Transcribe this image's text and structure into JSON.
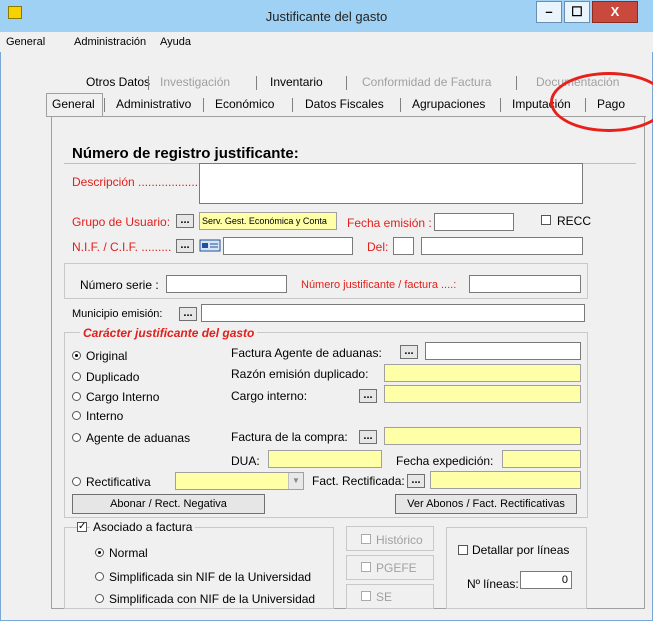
{
  "window": {
    "title": "Justificante del gasto",
    "min": "–",
    "max": "☐",
    "close": "X"
  },
  "menu": [
    "General",
    "Administración",
    "Ayuda"
  ],
  "tabs_row1": [
    "Otros Datos",
    "Investigación",
    "Inventario",
    "Conformidad de Factura",
    "Documentación"
  ],
  "tabs_row2": [
    "General",
    "Administrativo",
    "Económico",
    "Datos Fiscales",
    "Agrupaciones",
    "Imputación",
    "Pago"
  ],
  "form": {
    "header": "Número de registro justificante:",
    "descripcion": "Descripción ...................",
    "grupo_usuario": "Grupo de Usuario:",
    "grupo_value": "Serv. Gest. Económica y Conta",
    "fecha_emision": "Fecha emisión :",
    "recc": "RECC",
    "nif": "N.I.F. / C.I.F. .........",
    "del": "Del:",
    "numero_serie": "Número serie :",
    "numero_justificante": "Número justificante / factura ....:",
    "municipio": "Municipio emisión:",
    "dots_btn": "...",
    "nlineas_value": "0"
  },
  "caracter": {
    "title": "Carácter justificante del gasto",
    "options": [
      "Original",
      "Duplicado",
      "Cargo Interno",
      "Interno",
      "Agente de aduanas",
      "Rectificativa"
    ],
    "factura_agente": "Factura Agente de aduanas:",
    "razon_duplicado": "Razón emisión duplicado:",
    "cargo_interno": "Cargo interno:",
    "factura_compra": "Factura de la compra:",
    "dua": "DUA:",
    "fecha_expedicion": "Fecha expedición:",
    "fact_rectificada": "Fact. Rectificada:",
    "btn_abonar": "Abonar / Rect. Negativa",
    "btn_ver_abonos": "Ver Abonos / Fact. Rectificativas"
  },
  "asociado": {
    "title": "Asociado a factura",
    "options": [
      "Normal",
      "Simplificada sin NIF de la Universidad",
      "Simplificada con NIF de la Universidad"
    ],
    "historico": "Histórico",
    "pgefe": "PGEFE",
    "se": "SE",
    "detallar": "Detallar por líneas",
    "nlineas": "Nº líneas:"
  }
}
